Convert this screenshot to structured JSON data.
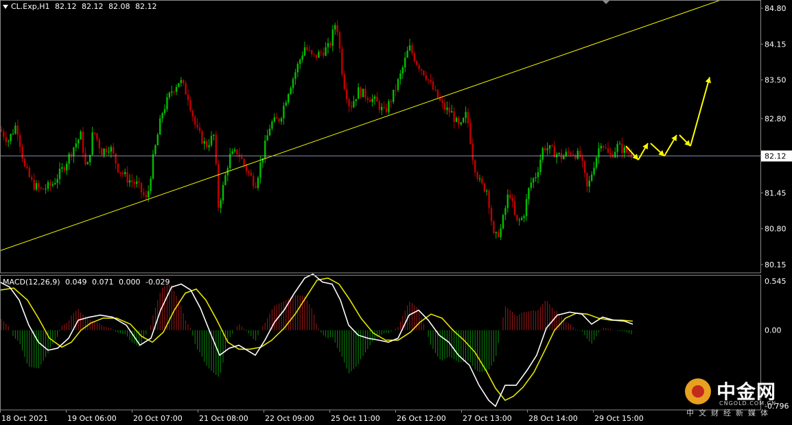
{
  "header": {
    "symbol": "CL.Exp,H1",
    "ohlc": [
      "82.12",
      "82.12",
      "82.08",
      "82.12"
    ]
  },
  "macd_header": {
    "label": "MACD(12,26,9)",
    "values": [
      "0.049",
      "0.071",
      "0.000",
      "-0.029"
    ]
  },
  "watermark": {
    "name": "中金网",
    "url": "CNGOLD.COM.CN",
    "sub": "中文财经新媒体"
  },
  "colors": {
    "background": "#000000",
    "bull": "#00c000",
    "bear": "#c00000",
    "trendline": "#ffff00",
    "macd_line": "#ffffff",
    "signal_line": "#e6e600",
    "hist_pos": "#a01818",
    "hist_neg": "#0a8a0a",
    "grid": "#9aa0c0"
  },
  "chart_data": [
    {
      "type": "candlestick",
      "symbol": "CL.Exp",
      "timeframe": "H1",
      "ylim": [
        80.0,
        84.95
      ],
      "y_ticks": [
        "84.80",
        "84.15",
        "83.50",
        "82.80",
        "82.12",
        "81.45",
        "80.80",
        "80.15"
      ],
      "x_ticks": [
        "18 Oct 2021",
        "19 Oct 06:00",
        "20 Oct 07:00",
        "21 Oct 08:00",
        "22 Oct 09:00",
        "25 Oct 11:00",
        "26 Oct 12:00",
        "27 Oct 13:00",
        "28 Oct 14:00",
        "29 Oct 15:00"
      ],
      "current_price": "82.12",
      "price_path": [
        [
          0,
          82.6
        ],
        [
          12,
          82.4
        ],
        [
          24,
          82.7
        ],
        [
          36,
          81.9
        ],
        [
          48,
          81.6
        ],
        [
          60,
          81.5
        ],
        [
          76,
          81.6
        ],
        [
          92,
          81.9
        ],
        [
          108,
          82.3
        ],
        [
          118,
          82.5
        ],
        [
          126,
          81.8
        ],
        [
          136,
          82.6
        ],
        [
          148,
          82.2
        ],
        [
          160,
          82.3
        ],
        [
          172,
          81.9
        ],
        [
          186,
          81.7
        ],
        [
          200,
          81.6
        ],
        [
          214,
          81.3
        ],
        [
          222,
          82.0
        ],
        [
          236,
          82.9
        ],
        [
          250,
          83.3
        ],
        [
          262,
          83.5
        ],
        [
          274,
          83.2
        ],
        [
          286,
          82.6
        ],
        [
          300,
          82.3
        ],
        [
          312,
          82.5
        ],
        [
          318,
          81.2
        ],
        [
          326,
          81.6
        ],
        [
          334,
          82.1
        ],
        [
          346,
          82.2
        ],
        [
          358,
          81.9
        ],
        [
          372,
          81.6
        ],
        [
          380,
          82.0
        ],
        [
          394,
          82.7
        ],
        [
          408,
          82.8
        ],
        [
          420,
          83.3
        ],
        [
          432,
          83.7
        ],
        [
          444,
          84.1
        ],
        [
          456,
          83.9
        ],
        [
          468,
          84.0
        ],
        [
          480,
          84.1
        ],
        [
          490,
          84.6
        ],
        [
          500,
          83.5
        ],
        [
          510,
          83.0
        ],
        [
          522,
          83.3
        ],
        [
          536,
          83.2
        ],
        [
          548,
          83.1
        ],
        [
          560,
          82.9
        ],
        [
          572,
          83.2
        ],
        [
          584,
          83.6
        ],
        [
          596,
          84.1
        ],
        [
          608,
          83.8
        ],
        [
          620,
          83.6
        ],
        [
          632,
          83.3
        ],
        [
          646,
          83.0
        ],
        [
          658,
          82.9
        ],
        [
          670,
          82.6
        ],
        [
          680,
          82.9
        ],
        [
          690,
          82.0
        ],
        [
          700,
          81.6
        ],
        [
          710,
          81.5
        ],
        [
          720,
          80.6
        ],
        [
          730,
          80.8
        ],
        [
          742,
          81.5
        ],
        [
          752,
          80.9
        ],
        [
          762,
          81.0
        ],
        [
          772,
          81.6
        ],
        [
          782,
          81.8
        ],
        [
          792,
          82.3
        ],
        [
          806,
          82.2
        ],
        [
          818,
          82.1
        ],
        [
          832,
          82.2
        ],
        [
          846,
          82.1
        ],
        [
          856,
          81.5
        ],
        [
          866,
          82.0
        ],
        [
          876,
          82.4
        ],
        [
          888,
          82.1
        ],
        [
          900,
          82.3
        ],
        [
          912,
          82.2
        ],
        [
          922,
          82.15
        ]
      ],
      "trendline": {
        "start": [
          0,
          80.4
        ],
        "end": [
          1154,
          85.4
        ]
      },
      "forecast_arrows": [
        [
          [
            912,
            82.3
          ],
          [
            930,
            82.05
          ]
        ],
        [
          [
            930,
            82.05
          ],
          [
            944,
            82.35
          ]
        ],
        [
          [
            948,
            82.35
          ],
          [
            968,
            82.12
          ]
        ],
        [
          [
            968,
            82.12
          ],
          [
            986,
            82.5
          ]
        ],
        [
          [
            990,
            82.5
          ],
          [
            1006,
            82.3
          ]
        ],
        [
          [
            1006,
            82.3
          ],
          [
            1034,
            83.55
          ]
        ]
      ]
    },
    {
      "type": "macd",
      "label": "MACD(12,26,9)",
      "ylim": [
        -0.796,
        0.545
      ],
      "y_ticks": [
        "0.545",
        "0.00",
        "-0.796"
      ],
      "macd": [
        [
          0,
          0.48
        ],
        [
          14,
          0.43
        ],
        [
          28,
          0.3
        ],
        [
          42,
          0.05
        ],
        [
          56,
          -0.12
        ],
        [
          70,
          -0.2
        ],
        [
          84,
          -0.18
        ],
        [
          100,
          -0.08
        ],
        [
          114,
          0.1
        ],
        [
          130,
          0.13
        ],
        [
          146,
          0.15
        ],
        [
          164,
          0.13
        ],
        [
          184,
          0.05
        ],
        [
          204,
          -0.15
        ],
        [
          220,
          -0.08
        ],
        [
          234,
          0.2
        ],
        [
          250,
          0.43
        ],
        [
          264,
          0.46
        ],
        [
          278,
          0.4
        ],
        [
          292,
          0.22
        ],
        [
          306,
          -0.02
        ],
        [
          320,
          -0.25
        ],
        [
          334,
          -0.18
        ],
        [
          348,
          -0.15
        ],
        [
          360,
          -0.2
        ],
        [
          372,
          -0.25
        ],
        [
          386,
          -0.1
        ],
        [
          400,
          0.08
        ],
        [
          414,
          0.2
        ],
        [
          428,
          0.36
        ],
        [
          444,
          0.52
        ],
        [
          456,
          0.56
        ],
        [
          470,
          0.48
        ],
        [
          484,
          0.46
        ],
        [
          496,
          0.3
        ],
        [
          508,
          0.05
        ],
        [
          522,
          -0.05
        ],
        [
          536,
          -0.08
        ],
        [
          552,
          -0.1
        ],
        [
          566,
          -0.12
        ],
        [
          580,
          -0.08
        ],
        [
          596,
          0.15
        ],
        [
          610,
          0.2
        ],
        [
          624,
          0.1
        ],
        [
          640,
          -0.05
        ],
        [
          654,
          -0.12
        ],
        [
          668,
          -0.25
        ],
        [
          684,
          -0.35
        ],
        [
          698,
          -0.55
        ],
        [
          712,
          -0.7
        ],
        [
          722,
          -0.76
        ],
        [
          736,
          -0.55
        ],
        [
          752,
          -0.55
        ],
        [
          768,
          -0.4
        ],
        [
          782,
          -0.25
        ],
        [
          796,
          0.02
        ],
        [
          812,
          0.15
        ],
        [
          830,
          0.18
        ],
        [
          848,
          0.16
        ],
        [
          862,
          0.06
        ],
        [
          878,
          0.13
        ],
        [
          894,
          0.1
        ],
        [
          910,
          0.09
        ],
        [
          922,
          0.06
        ]
      ],
      "signal": [
        [
          0,
          0.4
        ],
        [
          20,
          0.42
        ],
        [
          40,
          0.3
        ],
        [
          56,
          0.12
        ],
        [
          72,
          -0.08
        ],
        [
          90,
          -0.17
        ],
        [
          104,
          -0.12
        ],
        [
          118,
          0.0
        ],
        [
          132,
          0.07
        ],
        [
          150,
          0.12
        ],
        [
          170,
          0.12
        ],
        [
          190,
          0.06
        ],
        [
          206,
          -0.06
        ],
        [
          222,
          -0.12
        ],
        [
          238,
          -0.02
        ],
        [
          254,
          0.2
        ],
        [
          270,
          0.37
        ],
        [
          286,
          0.41
        ],
        [
          300,
          0.3
        ],
        [
          316,
          0.1
        ],
        [
          332,
          -0.12
        ],
        [
          348,
          -0.19
        ],
        [
          364,
          -0.19
        ],
        [
          380,
          -0.17
        ],
        [
          396,
          -0.1
        ],
        [
          414,
          0.02
        ],
        [
          430,
          0.16
        ],
        [
          446,
          0.33
        ],
        [
          462,
          0.5
        ],
        [
          478,
          0.52
        ],
        [
          494,
          0.46
        ],
        [
          510,
          0.3
        ],
        [
          526,
          0.12
        ],
        [
          544,
          -0.03
        ],
        [
          562,
          -0.1
        ],
        [
          580,
          -0.1
        ],
        [
          598,
          -0.02
        ],
        [
          612,
          0.08
        ],
        [
          628,
          0.16
        ],
        [
          644,
          0.12
        ],
        [
          660,
          0.0
        ],
        [
          676,
          -0.1
        ],
        [
          692,
          -0.22
        ],
        [
          708,
          -0.4
        ],
        [
          722,
          -0.58
        ],
        [
          736,
          -0.7
        ],
        [
          748,
          -0.66
        ],
        [
          762,
          -0.57
        ],
        [
          778,
          -0.42
        ],
        [
          794,
          -0.2
        ],
        [
          808,
          0.0
        ],
        [
          824,
          0.12
        ],
        [
          840,
          0.17
        ],
        [
          856,
          0.16
        ],
        [
          872,
          0.12
        ],
        [
          890,
          0.1
        ],
        [
          906,
          0.1
        ],
        [
          922,
          0.09
        ]
      ]
    }
  ]
}
